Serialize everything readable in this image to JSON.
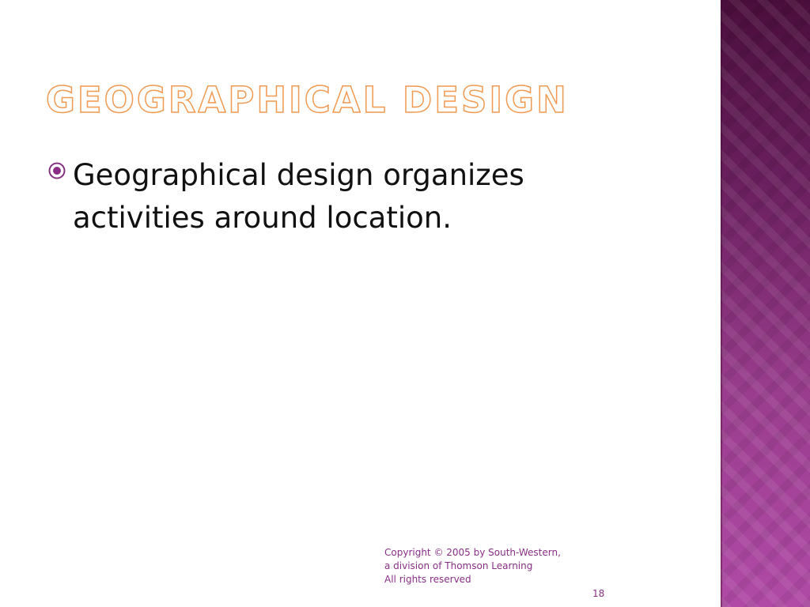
{
  "slide": {
    "title": "Geographical Design",
    "bullets": [
      "Geographical design organizes activities around location."
    ],
    "footer": {
      "copyright_line1": "Copyright © 2005 by South-Western, a division of Thomson Learning",
      "copyright_line2": "All rights reserved",
      "page_number": "18"
    }
  },
  "colors": {
    "title_outline": "#f09a52",
    "accent": "#8a2f86",
    "panel_top": "#4a0e3c",
    "panel_bottom": "#b04aa6"
  },
  "icons": {
    "bullet": "circled-dot-bullet-icon"
  }
}
